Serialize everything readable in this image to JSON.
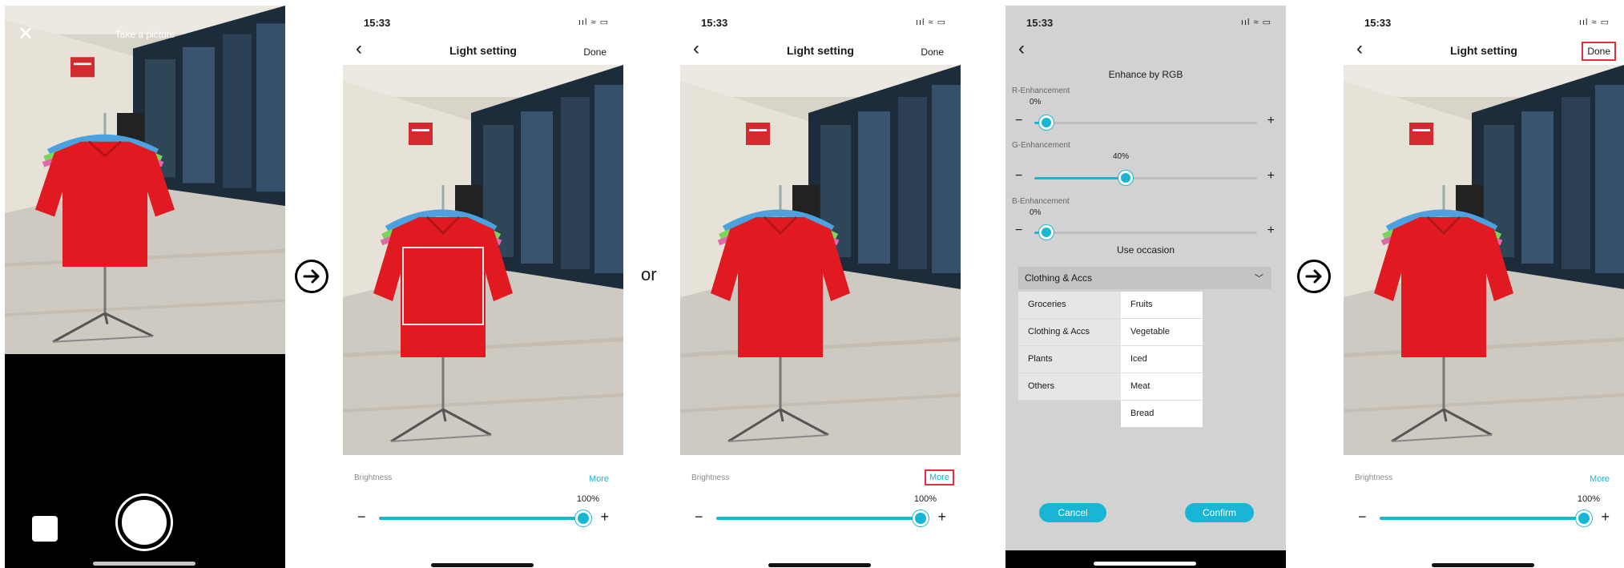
{
  "capture": {
    "close_icon": "close-icon",
    "title": "Take a picture"
  },
  "status": {
    "time": "15:33",
    "icons": "ııl ≈ ▭"
  },
  "light_setting": {
    "title": "Light setting",
    "done_label": "Done",
    "brightness_label": "Brightness",
    "more_label": "More",
    "brightness_value": "100%",
    "brightness_level": 1.0,
    "minus": "−",
    "plus": "+"
  },
  "enhance": {
    "title": "Enhance by RGB",
    "channels": [
      {
        "label": "R-Enhancement",
        "value": "0%",
        "level": 0.0
      },
      {
        "label": "G-Enhancement",
        "value": "40%",
        "level": 0.4
      },
      {
        "label": "B-Enhancement",
        "value": "0%",
        "level": 0.0
      }
    ],
    "occasion_title": "Use occasion",
    "occasion_selected": "Clothing & Accs",
    "categories": [
      "Groceries",
      "Clothing & Accs",
      "Plants",
      "Others"
    ],
    "subcategories": [
      "Fruits",
      "Vegetable",
      "Iced",
      "Meat",
      "Bread"
    ],
    "cancel_label": "Cancel",
    "confirm_label": "Confirm"
  },
  "connector_text": "or",
  "colors": {
    "accent": "#18b6d4",
    "highlight": "#e03040",
    "shirt": "#e11a22"
  }
}
